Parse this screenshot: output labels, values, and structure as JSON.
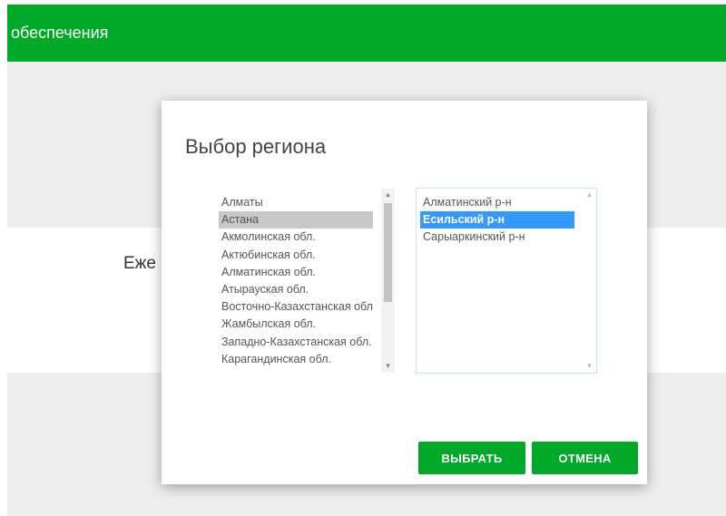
{
  "header": {
    "title_fragment": "обеспечения"
  },
  "background": {
    "partial_text": "Еже"
  },
  "dialog": {
    "title": "Выбор региона",
    "regions": [
      "Алматы",
      "Астана",
      "Акмолинская обл.",
      "Актюбинская обл.",
      "Алматинская обл.",
      "Атырауская обл.",
      "Восточно-Казахстанская обл.",
      "Жамбылская обл.",
      "Западно-Казахстанская обл.",
      "Карагандинская обл."
    ],
    "selected_region": "Астана",
    "districts": [
      "Алматинский р-н",
      "Есильский р-н",
      "Сарыаркинский р-н"
    ],
    "selected_district": "Есильский р-н",
    "buttons": {
      "select": "ВЫБРАТЬ",
      "cancel": "ОТМЕНА"
    },
    "icons": {
      "scroll_up": "triangle-up-icon",
      "scroll_down": "triangle-down-icon"
    }
  },
  "colors": {
    "brand_green": "#00a927",
    "selection_blue": "#3399ff",
    "selection_gray": "#c8c8c8"
  }
}
